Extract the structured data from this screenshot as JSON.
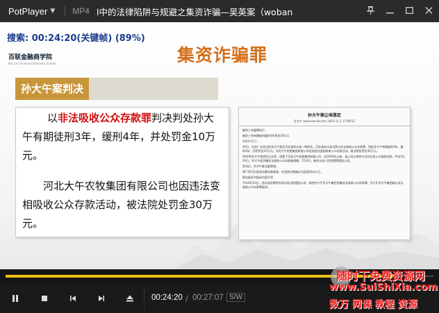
{
  "window": {
    "brand": "PotPlayer",
    "format": "MP4",
    "title": "l中的法律陷阱与规避之集资诈骗—吴英案（woban",
    "buttons": [
      "pin-icon",
      "minimize-icon",
      "maximize-icon",
      "close-icon"
    ]
  },
  "osd": {
    "label": "搜索",
    "info": ": 00:24:20(关键帧) (89%)"
  },
  "slide": {
    "logo": "百联金融商学院",
    "logo_sub": "Bai Lian Financial Business School",
    "title": "集资诈骗罪",
    "case_label": "孙大午案判决",
    "para1_prefix": "以",
    "para1_highlight": "非法吸收公众存款罪",
    "para1_rest": "判决判处孙大午有期徒刑3年，缓刑4年，并处罚金10万元。",
    "para2": "河北大午农牧集团有限公司也因违法变相吸收公众存款活动，被法院处罚金30万元。",
    "doc": {
      "title": "孙大午案尘埃落定",
      "meta": "孙大午  www.law-lib.com   2003-11-1  17:08:52",
      "lines": [
        "被判三年缓期执行",
        "被判三年有期徒刑缓刑4年罚金30万元",
        "2003-11-1",
        "30日，社会广泛关注的孙大午案在河北省徐水县一审判决，河北省徐水县法院以非法吸收公众存款罪，判处孙大午有期徒刑3年，缓刑4年，并处罚金10万元；河北大午农牧集团有限公司也因违法变相吸收公众存款活动，被法院处罚金30万元。",
        "49岁的孙大午是农民企业家，创建了河北大午农牧集团有限公司，自2000年以来，该公司以多种方式向社会公众吸收存款。今年5月29日，孙大午因涉嫌非法吸收公众存款被逮捕，7月4日，被徐水县人民检察院提起公诉。",
        "判决后，孙大午被当庭释放。",
        "两个多月后因违法事实被查清，社会舆论普遍认为此案判决公正。",
        "两次起诉书起诉内容不同",
        "今年9月10日，徐水县检察院向徐水县法院提起公诉，指控孙大午及大午集团涉嫌非法吸收公众存款罪。孙大午及大午集团被以非法吸收公众存款罪起诉。"
      ]
    }
  },
  "playback": {
    "progress": 0.897,
    "current_time": "00:24:20",
    "separator": "/",
    "total_time": "00:27:07",
    "sw_label": "S/W",
    "buttons": [
      "pause-icon",
      "stop-icon",
      "previous-icon",
      "next-icon",
      "eject-icon"
    ]
  },
  "watermark": {
    "line1": "随时下免费资源网",
    "line2": "www.SuiShiXia.com",
    "line3": "数万 网课 教程 资源"
  },
  "colors": {
    "accent": "#f0c419",
    "title_orange": "#d4701c",
    "case_label_bg": "#c8963a",
    "highlight_red": "#d01010",
    "osd_blue": "#1a3a8a",
    "watermark_red": "#e22222"
  }
}
